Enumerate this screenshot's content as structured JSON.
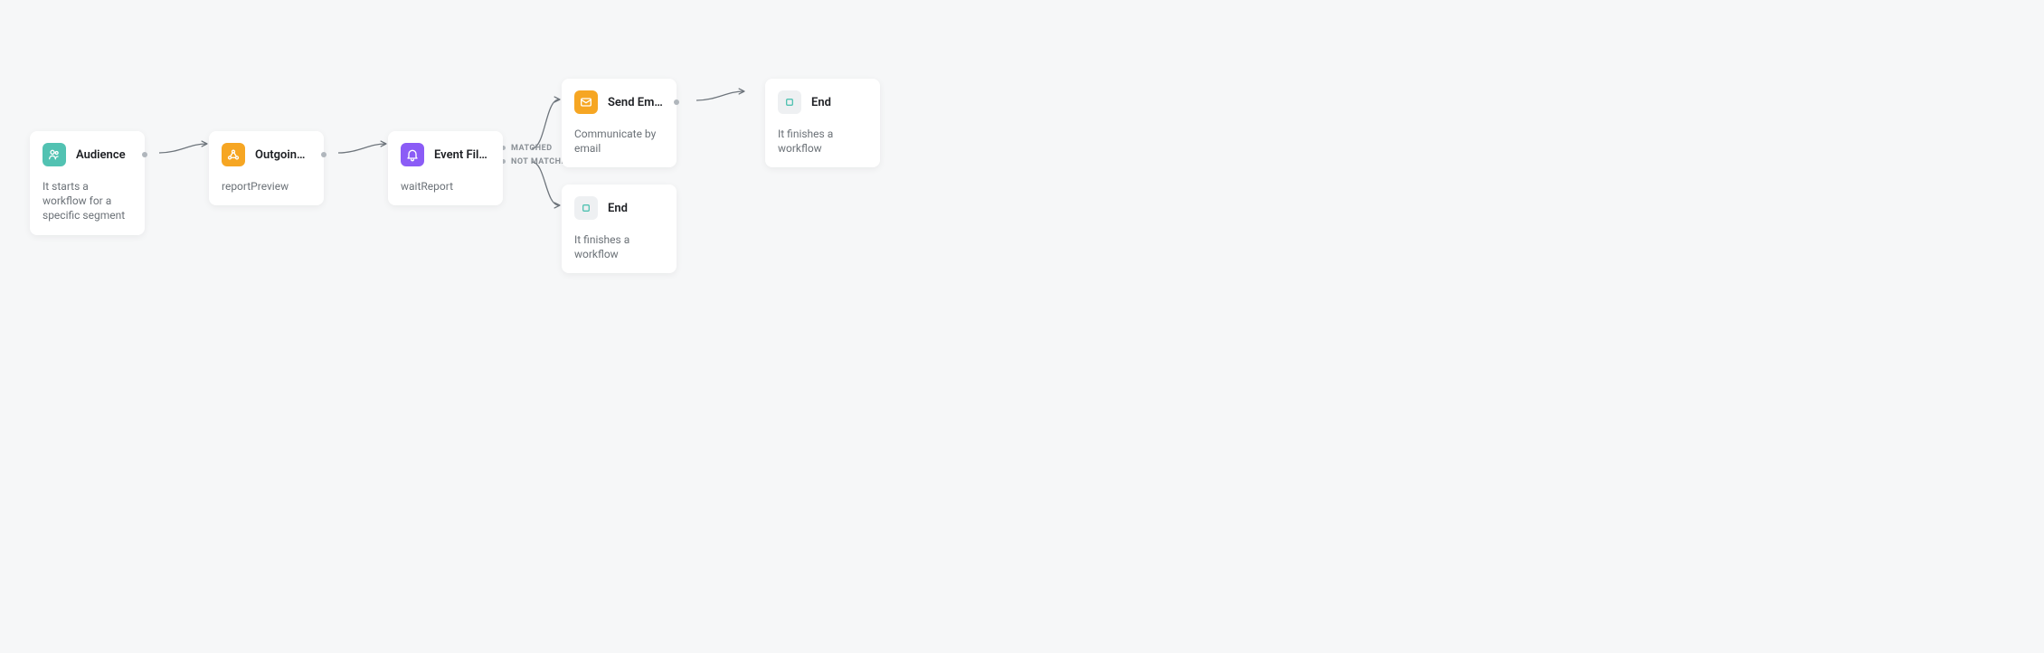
{
  "nodes": {
    "audience": {
      "title": "Audience",
      "desc": "It starts a workflow for a specific segment",
      "icon_color": "#52c2b2"
    },
    "outgoing": {
      "title": "Outgoing Integr…",
      "desc": "reportPreview",
      "icon_color": "#f6a623"
    },
    "event_filter": {
      "title": "Event Filter",
      "desc": "waitReport",
      "icon_color": "#8b5cf6"
    },
    "send_email": {
      "title": "Send Email",
      "desc": "Communicate by email",
      "icon_color": "#f6a623"
    },
    "end_top": {
      "title": "End",
      "desc": "It finishes a workflow",
      "icon_color": "#eef0f2"
    },
    "end_bottom": {
      "title": "End",
      "desc": "It finishes a workflow",
      "icon_color": "#eef0f2"
    }
  },
  "branches": {
    "matched": "MATCHED",
    "not_matched": "NOT MATCHED"
  }
}
